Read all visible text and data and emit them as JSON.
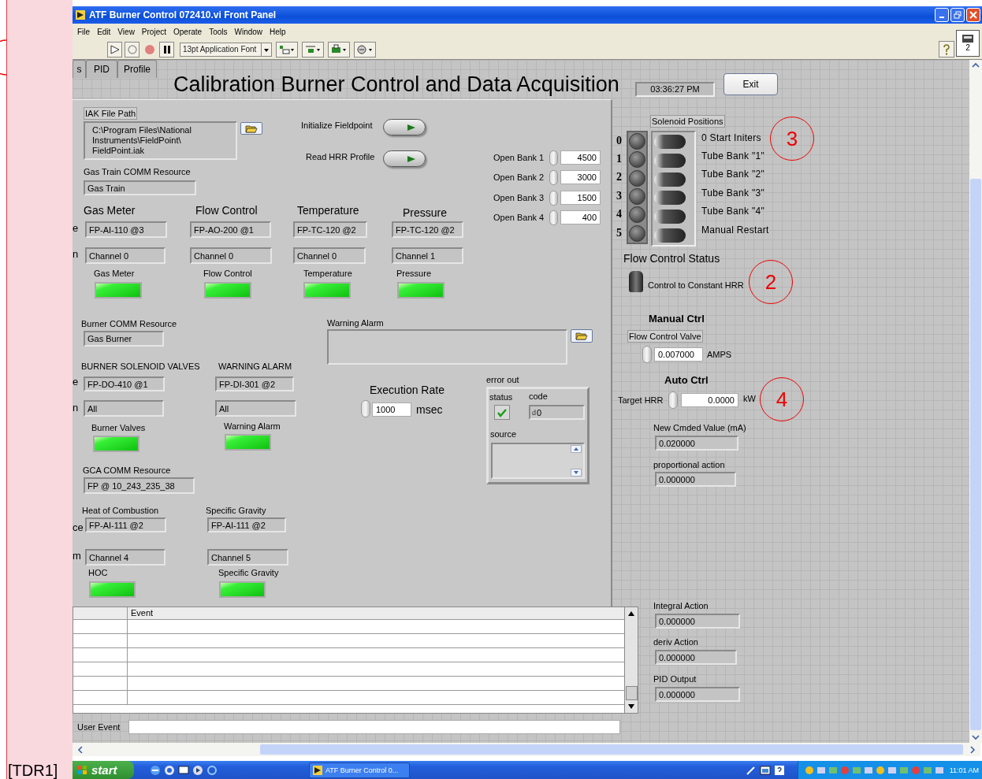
{
  "side_note": {
    "label": "[TDR1]"
  },
  "window": {
    "title": "ATF Burner Control 072410.vi Front Panel"
  },
  "menu": [
    "File",
    "Edit",
    "View",
    "Project",
    "Operate",
    "Tools",
    "Window",
    "Help"
  ],
  "toolbar": {
    "font": "13pt Application Font"
  },
  "connector_pane": {
    "label": "2"
  },
  "tabs": [
    {
      "label": "s",
      "selected": false
    },
    {
      "label": "PID",
      "selected": false
    },
    {
      "label": "Profile",
      "selected": false
    }
  ],
  "heading": "Calibration Burner Control and Data Acquisition",
  "clock": "03:36:27 PM",
  "exit_button": "Exit",
  "iak_file": {
    "label": "IAK File Path",
    "lines": [
      "C:\\Program Files\\National",
      "Instruments\\FieldPoint\\",
      "FieldPoint.iak"
    ]
  },
  "gas_train": {
    "label": "Gas Train COMM Resource",
    "value": "Gas Train"
  },
  "buttons": [
    {
      "label": "Initialize Fieldpoint"
    },
    {
      "label": "Read HRR Profile"
    }
  ],
  "open_banks": [
    {
      "label": "Open Bank 1",
      "value": "4500"
    },
    {
      "label": "Open Bank 2",
      "value": "3000"
    },
    {
      "label": "Open Bank 3",
      "value": "1500"
    },
    {
      "label": "Open Bank 4",
      "value": "400"
    }
  ],
  "sensor_edge_labels": [
    "e",
    "n"
  ],
  "sensors": [
    {
      "heading": "Gas Meter",
      "resource": "FP-AI-110 @3",
      "channel": "Channel 0",
      "indicator": "Gas Meter",
      "on": true
    },
    {
      "heading": "Flow Control",
      "resource": "FP-AO-200 @1",
      "channel": "Channel 0",
      "indicator": "Flow Control",
      "on": true
    },
    {
      "heading": "Temperature",
      "resource": "FP-TC-120 @2",
      "channel": "Channel 0",
      "indicator": "Temperature",
      "on": true
    },
    {
      "heading": "Pressure",
      "resource": "FP-TC-120 @2",
      "channel": "Channel 1",
      "indicator": "Pressure",
      "on": true
    }
  ],
  "burner_comm": {
    "label": "Burner COMM Resource",
    "value": "Gas Burner"
  },
  "warning_alarm": {
    "label": "Warning Alarm"
  },
  "valve_edge_labels": [
    "e",
    "n"
  ],
  "valves": [
    {
      "title": "BURNER SOLENOID VALVES",
      "resource": "FP-DO-410 @1",
      "channel": "All",
      "indicator": "Burner Valves",
      "on": true
    },
    {
      "title": "WARNING ALARM",
      "resource": "FP-DI-301 @2",
      "channel": "All",
      "indicator": "Warning Alarm",
      "on": true
    }
  ],
  "gca_comm": {
    "label": "GCA COMM Resource",
    "value": "FP @ 10_243_235_38"
  },
  "props_edge_labels": [
    "ce",
    "m"
  ],
  "gas_props": [
    {
      "title": "Heat of Combustion",
      "resource": "FP-AI-111 @2",
      "channel": "Channel 4",
      "indicator": "HOC",
      "on": true
    },
    {
      "title": "Specific Gravity",
      "resource": "FP-AI-111 @2",
      "channel": "Channel 5",
      "indicator": "Specific Gravity",
      "on": true
    }
  ],
  "execution_rate": {
    "label": "Execution Rate",
    "value": "1000",
    "unit": "msec"
  },
  "error_out": {
    "label": "error out",
    "status_label": "status",
    "status_ok": true,
    "code_label": "code",
    "radix": "d",
    "code": "0",
    "source_label": "source"
  },
  "solenoids": {
    "label": "Solenoid Positions",
    "items": [
      {
        "index": "0",
        "label": "0 Start Initers",
        "lit": false,
        "on": false
      },
      {
        "index": "1",
        "label": "Tube Bank \"1\"",
        "lit": false,
        "on": false
      },
      {
        "index": "2",
        "label": "Tube Bank \"2\"",
        "lit": false,
        "on": false
      },
      {
        "index": "3",
        "label": "Tube Bank \"3\"",
        "lit": false,
        "on": false
      },
      {
        "index": "4",
        "label": "Tube Bank \"4\"",
        "lit": false,
        "on": false
      },
      {
        "index": "5",
        "label": "Manual Restart",
        "lit": false,
        "on": false
      }
    ]
  },
  "flow_status": {
    "label": "Flow Control Status",
    "switch_label": "Control to Constant HRR",
    "on": false
  },
  "manual_ctrl": {
    "heading": "Manual Ctrl",
    "label": "Flow Control Valve",
    "value": "0.007000",
    "unit": "AMPS"
  },
  "auto_ctrl": {
    "heading": "Auto Ctrl",
    "label": "Target HRR",
    "value": "0.0000",
    "unit": "kW"
  },
  "outputs": [
    {
      "label": "New Cmded Value (mA)",
      "value": "0.020000"
    },
    {
      "label": "proportional action",
      "value": "0.000000"
    },
    {
      "label": "Integral Action",
      "value": "0.000000"
    },
    {
      "label": "deriv Action",
      "value": "0.000000"
    },
    {
      "label": "PID Output",
      "value": "0.000000"
    }
  ],
  "annotations": [
    {
      "label": "3"
    },
    {
      "label": "2"
    },
    {
      "label": "4"
    }
  ],
  "event_table": {
    "columns": [
      "Event"
    ]
  },
  "user_event": {
    "label": "User Event"
  },
  "taskbar": {
    "start": "start",
    "task": "ATF Burner Control 0...",
    "time": "11:01 AM"
  }
}
